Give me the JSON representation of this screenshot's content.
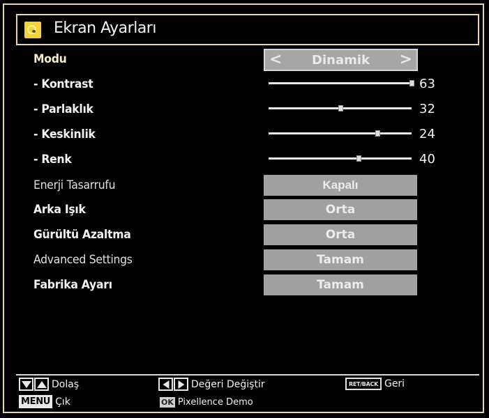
{
  "header": {
    "icon": "picture-settings-icon",
    "title": "Ekran Ayarları"
  },
  "mode": {
    "label": "Modu",
    "value": "Dinamik",
    "left_arrow": "<",
    "right_arrow": ">"
  },
  "sliders": [
    {
      "label": "- Kontrast",
      "value": "63",
      "fraction": 1.0
    },
    {
      "label": "- Parlaklık",
      "value": "32",
      "fraction": 0.5
    },
    {
      "label": "- Keskinlik",
      "value": "24",
      "fraction": 0.76
    },
    {
      "label": "- Renk",
      "value": "40",
      "fraction": 0.63
    }
  ],
  "options": [
    {
      "label": "Enerji Tasarrufu",
      "value": "Kapalı"
    },
    {
      "label": "Arka Işık",
      "value": "Orta"
    },
    {
      "label": "Gürültü Azaltma",
      "value": "Orta"
    },
    {
      "label": "Advanced Settings",
      "value": "Tamam"
    },
    {
      "label": "Fabrika Ayarı",
      "value": "Tamam"
    }
  ],
  "help": {
    "navigate": "Dolaş",
    "change_value": "Değeri Değiştir",
    "back_key": "RET/BACK",
    "back": "Geri",
    "menu_key": "MENU",
    "exit": "Çık",
    "ok_key": "OK",
    "demo": "Pixellence Demo"
  },
  "colors": {
    "frame": "#e6d9a8",
    "value_box": "#a0a0a0",
    "selected_label": "#f3efc5",
    "icon_yellow": "#f3d33a"
  }
}
